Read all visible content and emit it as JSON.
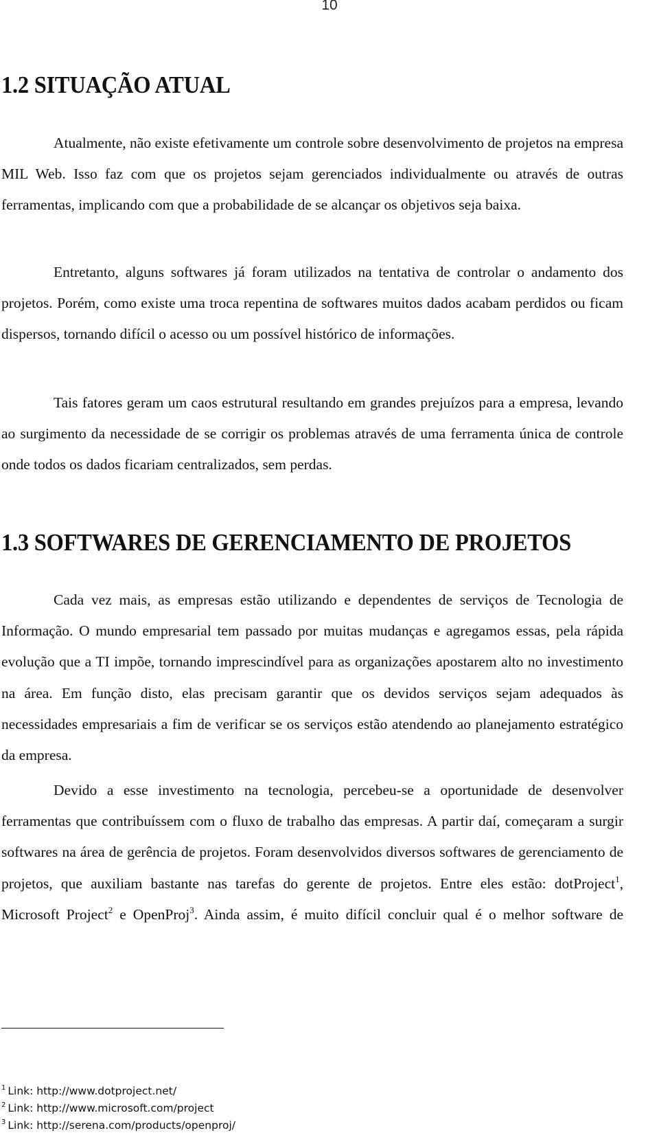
{
  "page_number": "10",
  "sections": [
    {
      "heading": "1.2 SITUAÇÃO ATUAL",
      "paragraphs": [
        "Atualmente, não existe efetivamente um controle sobre desenvolvimento de projetos na empresa MIL Web. Isso faz com que os projetos sejam gerenciados individualmente ou através de outras ferramentas, implicando com que a probabilidade de se alcançar os objetivos seja baixa.",
        "Entretanto, alguns softwares já foram utilizados na tentativa de controlar o andamento dos projetos. Porém, como existe uma troca repentina de softwares muitos dados acabam perdidos ou ficam dispersos, tornando difícil o acesso ou um possível histórico de informações.",
        "Tais fatores geram um caos estrutural resultando em grandes prejuízos para a empresa, levando ao surgimento da necessidade de se corrigir os problemas através de uma ferramenta única de controle onde todos os dados ficariam centralizados, sem perdas."
      ]
    },
    {
      "heading": "1.3 SOFTWARES DE GERENCIAMENTO DE PROJETOS",
      "paragraphs": [
        "Cada vez mais, as empresas estão utilizando e dependentes de serviços de Tecnologia de Informação. O mundo empresarial tem passado por muitas mudanças e agregamos essas, pela rápida evolução que a TI impõe, tornando imprescindível para as organizações apostarem alto no investimento na área. Em função disto, elas precisam garantir que os devidos serviços sejam adequados às necessidades empresariais a fim de verificar se os serviços estão atendendo ao planejamento estratégico da empresa."
      ],
      "last_paragraph": {
        "text_1": "Devido a esse investimento na tecnologia, percebeu-se a oportunidade de desenvolver ferramentas que contribuíssem com o fluxo de trabalho das empresas. A partir daí, começaram a surgir softwares na área de gerência de projetos. Foram desenvolvidos diversos softwares de gerenciamento de projetos, que auxiliam bastante nas tarefas do gerente de projetos. Entre eles estão: dotProject",
        "sup_1": "1",
        "text_2": ", Microsoft Project",
        "sup_2": "2",
        "text_3": " e OpenProj",
        "sup_3": "3",
        "text_4": ". Ainda assim, é muito difícil concluir qual é o melhor software de"
      }
    }
  ],
  "footnotes": [
    {
      "mark": "1",
      "text": "Link: http://www.dotproject.net/"
    },
    {
      "mark": "2",
      "text": "Link: http://www.microsoft.com/project"
    },
    {
      "mark": "3",
      "text": "Link: http://serena.com/products/openproj/"
    }
  ]
}
